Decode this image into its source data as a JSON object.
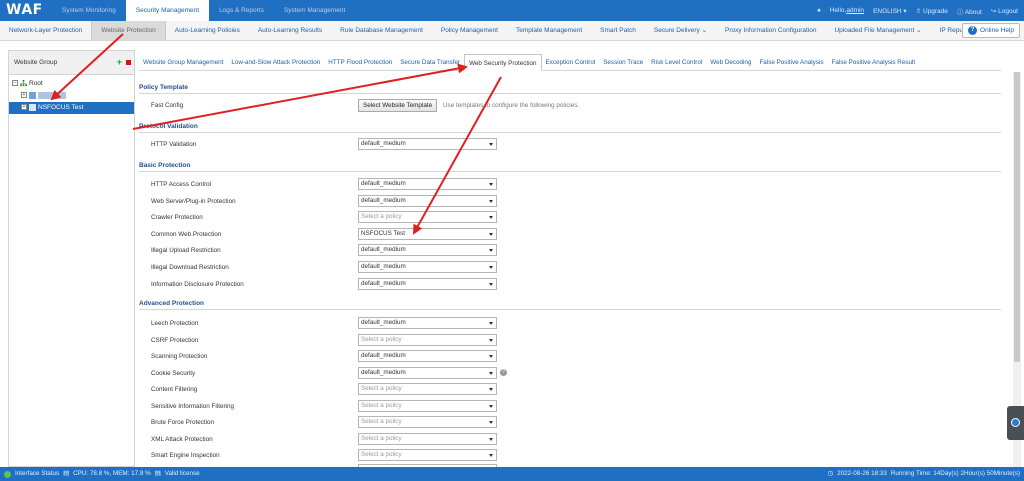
{
  "app": {
    "logo": "WAF"
  },
  "top_nav": [
    "System Monitoring",
    "Security Management",
    "Logs & Reports",
    "System Management"
  ],
  "top_nav_active": "Security Management",
  "user": {
    "hello": "Hello,",
    "name": "admin",
    "language": "ENGLISH",
    "upgrade": "Upgrade",
    "about": "About",
    "logout": "Logout"
  },
  "sub_nav": [
    "Network-Layer Protection",
    "Website Protection",
    "Auto-Learning Policies",
    "Auto-Learning Results",
    "Rule Database Management",
    "Policy Management",
    "Template Management",
    "Smart Patch",
    "Secure Delivery",
    "Proxy Information Configuration",
    "Uploaded File Management",
    "IP Reputation"
  ],
  "sub_nav_active": "Website Protection",
  "help_button": "Online Help",
  "left_panel": {
    "title": "Website Group",
    "tree": {
      "root": "Root",
      "selected": "NSFOCUS Test"
    }
  },
  "tabs": [
    "Website Group Management",
    "Low-and-Slow Attack Protection",
    "HTTP Flood Protection",
    "Secure Data Transfer",
    "Web Security Protection",
    "Exception Control",
    "Session Trace",
    "Risk Level Control",
    "Web Decoding",
    "False Positive Analysis",
    "False Positive Analysis Result"
  ],
  "active_tab": "Web Security Protection",
  "sections": {
    "policy_template": {
      "title": "Policy Template",
      "fast_config_label": "Fast Config",
      "button": "Select Website Template",
      "hint": "Use templates to configure the following policies."
    },
    "protocol_validation": {
      "title": "Protocol Validation",
      "rows": [
        {
          "label": "HTTP Validation",
          "value": "default_medium"
        }
      ]
    },
    "basic_protection": {
      "title": "Basic Protection",
      "rows": [
        {
          "label": "HTTP Access Control",
          "value": "default_medium"
        },
        {
          "label": "Web Server/Plug-in Protection",
          "value": "default_medium"
        },
        {
          "label": "Crawler Protection",
          "value": "Select a policy"
        },
        {
          "label": "Common Web Protection",
          "value": "NSFOCUS Test"
        },
        {
          "label": "Illegal Upload Restriction",
          "value": "default_medium"
        },
        {
          "label": "Illegal Download Restriction",
          "value": "default_medium"
        },
        {
          "label": "Information Disclosure Protection",
          "value": "default_medium"
        }
      ]
    },
    "advanced_protection": {
      "title": "Advanced Protection",
      "rows": [
        {
          "label": "Leech Protection",
          "value": "default_medium"
        },
        {
          "label": "CSRF Protection",
          "value": "Select a policy"
        },
        {
          "label": "Scanning Protection",
          "value": "default_medium"
        },
        {
          "label": "Cookie Security",
          "value": "default_medium"
        },
        {
          "label": "Content Filtering",
          "value": "Select a policy"
        },
        {
          "label": "Sensitive Information Filtering",
          "value": "Select a policy"
        },
        {
          "label": "Brute Force Protection",
          "value": "Select a policy"
        },
        {
          "label": "XML Attack Protection",
          "value": "Select a policy"
        },
        {
          "label": "Smart Engine Inspection",
          "value": "Select a policy"
        }
      ]
    }
  },
  "status_bar": {
    "interface": "Interface Status",
    "cpu_mem": "CPU: 78.8 %, MEM: 17.9 %",
    "license": "Valid license",
    "datetime": "2022-08-26 18:33",
    "running_time": "Running Time:  14Day(s) 2Hour(s) 50Minute(s)"
  },
  "colors": {
    "header_blue": "#1f6fc3",
    "link_blue": "#1f5fa8",
    "annotation_red": "#e02020"
  }
}
